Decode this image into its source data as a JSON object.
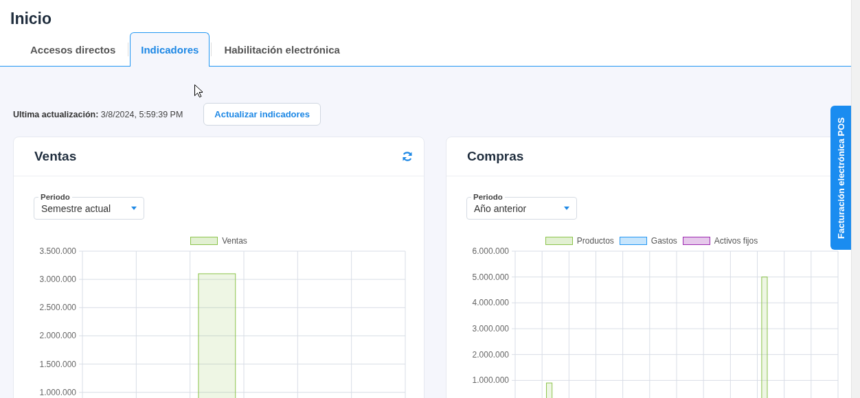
{
  "page": {
    "title": "Inicio"
  },
  "tabs": [
    {
      "label": "Accesos directos",
      "selected": false
    },
    {
      "label": "Indicadores",
      "selected": true
    },
    {
      "label": "Habilitación electrónica",
      "selected": false
    }
  ],
  "update": {
    "text": "**Ultima actualización:** 3/8/2024, 5:59:39 PM",
    "button": "Actualizar indicadores"
  },
  "cards": [
    {
      "title": "Ventas",
      "period_label": "Periodo",
      "period": "Semestre actual",
      "chart_data": {
        "type": "bar",
        "ylim": [
          0,
          3500000
        ],
        "yticks": [
          {
            "value": 3500000,
            "label": "3.500.000"
          },
          {
            "value": 3000000,
            "label": "3.000.000"
          },
          {
            "value": 2500000,
            "label": "2.500.000"
          },
          {
            "value": 2000000,
            "label": "2.000.000"
          },
          {
            "value": 1500000,
            "label": "1.500.000"
          },
          {
            "value": 1000000,
            "label": "1.000.000"
          }
        ],
        "series": [
          {
            "name": "Ventas",
            "color": "#8bc34a",
            "values": [
              null,
              null,
              3100000,
              null,
              null,
              null
            ]
          }
        ],
        "grid": true
      }
    },
    {
      "title": "Compras",
      "period_label": "Periodo",
      "period": "Año anterior",
      "chart_data": {
        "type": "bar",
        "ylim": [
          0,
          6000000
        ],
        "yticks": [
          {
            "value": 6000000,
            "label": "6.000.000"
          },
          {
            "value": 5000000,
            "label": "5.000.000"
          },
          {
            "value": 4000000,
            "label": "4.000.000"
          },
          {
            "value": 3000000,
            "label": "3.000.000"
          },
          {
            "value": 2000000,
            "label": "2.000.000"
          },
          {
            "value": 1000000,
            "label": "1.000.000"
          }
        ],
        "series": [
          {
            "name": "Productos",
            "color": "#8bc34a",
            "values": [
              null,
              900000,
              null,
              null,
              null,
              null,
              null,
              null,
              null,
              5000000,
              null,
              null
            ]
          },
          {
            "name": "Gastos",
            "color": "#2196f3",
            "values": [
              null,
              null,
              null,
              null,
              null,
              null,
              null,
              null,
              null,
              null,
              null,
              null
            ]
          },
          {
            "name": "Activos fijos",
            "color": "#9c27b0",
            "values": [
              null,
              null,
              null,
              null,
              null,
              null,
              null,
              null,
              null,
              null,
              null,
              null
            ]
          }
        ],
        "grid": true
      }
    }
  ],
  "side_tab": {
    "label": "Facturación electrónica POS"
  }
}
